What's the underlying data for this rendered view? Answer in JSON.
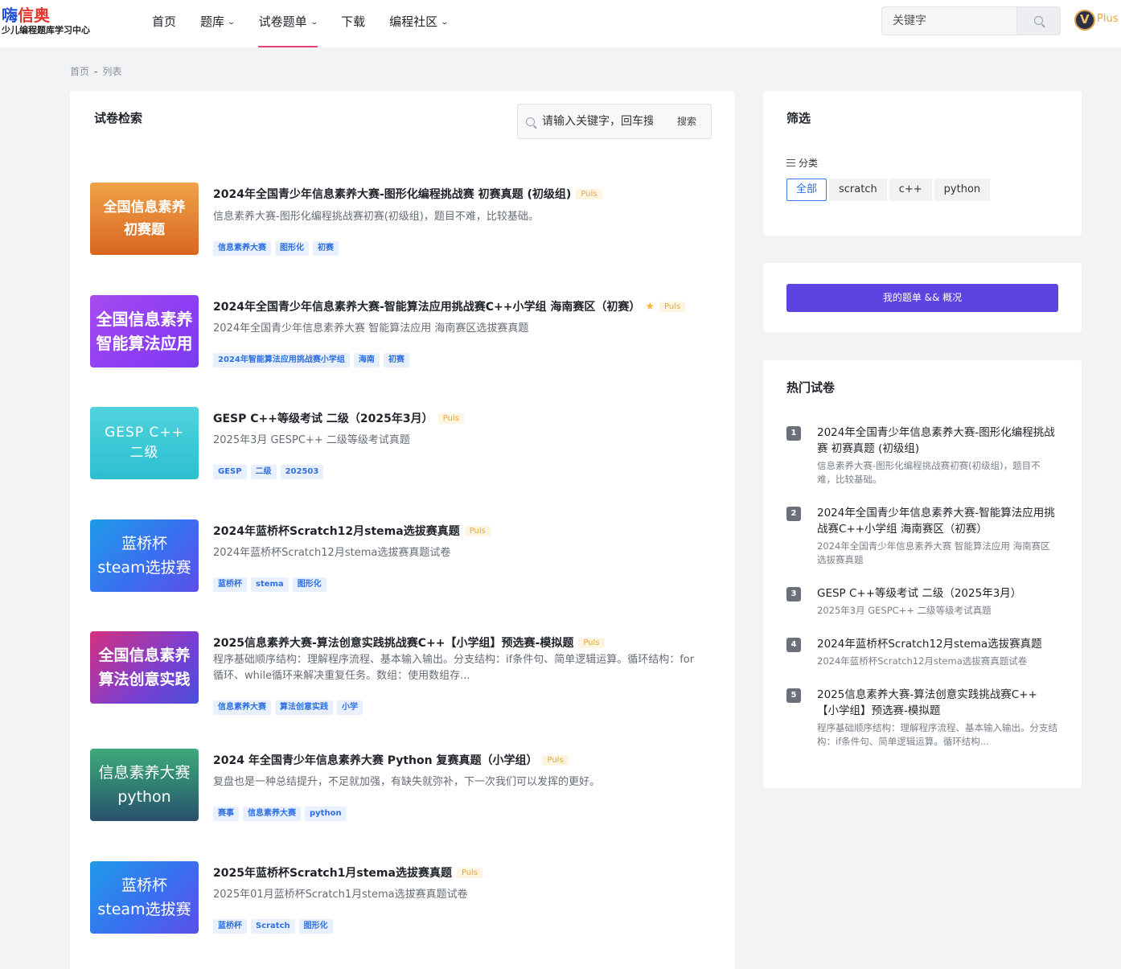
{
  "header": {
    "logo_main_blue": "嗨",
    "logo_main_red": "信奥",
    "logo_sub": "少儿编程题库学习中心",
    "nav": [
      {
        "label": "首页",
        "dropdown": false,
        "active": false
      },
      {
        "label": "题库",
        "dropdown": true,
        "active": false
      },
      {
        "label": "试卷题单",
        "dropdown": true,
        "active": true
      },
      {
        "label": "下载",
        "dropdown": false,
        "active": false
      },
      {
        "label": "编程社区",
        "dropdown": true,
        "active": false
      }
    ],
    "search_placeholder": "关键字",
    "plus_label": "Plus"
  },
  "breadcrumb": {
    "home": "首页",
    "sep": "-",
    "current": "列表"
  },
  "main": {
    "title": "试卷检索",
    "search_placeholder": "请输入关键字，回车搜索",
    "search_button": "搜索",
    "puls_label": "Puls",
    "items": [
      {
        "cover_lines": [
          "全国信息素养",
          "初赛题"
        ],
        "cover_style": "orange",
        "title": "2024年全国青少年信息素养大赛-图形化编程挑战赛 初赛真题 (初级组)",
        "starred": false,
        "desc": "信息素养大赛-图形化编程挑战赛初赛(初级组)，题目不难，比较基础。",
        "tags": [
          "信息素养大赛",
          "图形化",
          "初赛"
        ]
      },
      {
        "cover_lines": [
          "全国信息素养",
          "智能算法应用"
        ],
        "cover_style": "purple",
        "title": "2024年全国青少年信息素养大赛-智能算法应用挑战赛C++小学组 海南赛区（初赛）",
        "starred": true,
        "desc": "2024年全国青少年信息素养大赛 智能算法应用 海南赛区选拔赛真题",
        "tags": [
          "2024年智能算法应用挑战赛小学组",
          "海南",
          "初赛"
        ]
      },
      {
        "cover_lines": [
          "GESP C++",
          "二级"
        ],
        "cover_style": "cyan",
        "title": "GESP C++等级考试 二级（2025年3月）",
        "starred": false,
        "desc": "2025年3月 GESPC++ 二级等级考试真题",
        "tags": [
          "GESP",
          "二级",
          "202503"
        ]
      },
      {
        "cover_lines": [
          "蓝桥杯",
          "steam选拔赛"
        ],
        "cover_style": "blue",
        "title": "2024年蓝桥杯Scratch12月stema选拔赛真题",
        "starred": false,
        "desc": "2024年蓝桥杯Scratch12月stema选拔赛真题试卷",
        "tags": [
          "蓝桥杯",
          "stema",
          "图形化"
        ]
      },
      {
        "cover_lines": [
          "全国信息素养",
          "算法创意实践"
        ],
        "cover_style": "magenta",
        "title": "2025信息素养大赛-算法创意实践挑战赛C++【小学组】预选赛-模拟题",
        "starred": false,
        "desc": "程序基础顺序结构：理解程序流程、基本输入输出。分支结构：if条件句、简单逻辑运算。循环结构：for循环、while循环来解决重复任务。数组：使用数组存...",
        "tags": [
          "信息素养大赛",
          "算法创意实践",
          "小学"
        ]
      },
      {
        "cover_lines": [
          "信息素养大赛",
          "python"
        ],
        "cover_style": "green",
        "title": "2024 年全国青少年信息素养大赛 Python 复赛真题（小学组）",
        "starred": false,
        "desc": "复盘也是一种总结提升，不足就加强，有缺失就弥补，下一次我们可以发挥的更好。",
        "tags": [
          "赛事",
          "信息素养大赛",
          "python"
        ]
      },
      {
        "cover_lines": [
          "蓝桥杯",
          "steam选拔赛"
        ],
        "cover_style": "blue",
        "title": "2025年蓝桥杯Scratch1月stema选拔赛真题",
        "starred": false,
        "desc": "2025年01月蓝桥杯Scratch1月stema选拔赛真题试卷",
        "tags": [
          "蓝桥杯",
          "Scratch",
          "图形化"
        ]
      }
    ]
  },
  "filter": {
    "title": "筛选",
    "category_label": "分类",
    "categories": [
      "全部",
      "scratch",
      "c++",
      "python"
    ],
    "active_category": "全部"
  },
  "my_list_button": "我的题单 && 概况",
  "hot": {
    "title": "热门试卷",
    "items": [
      {
        "rank": "1",
        "title": "2024年全国青少年信息素养大赛-图形化编程挑战赛 初赛真题 (初级组)",
        "desc": "信息素养大赛-图形化编程挑战赛初赛(初级组)，题目不难，比较基础。"
      },
      {
        "rank": "2",
        "title": "2024年全国青少年信息素养大赛-智能算法应用挑战赛C++小学组 海南赛区（初赛）",
        "desc": "2024年全国青少年信息素养大赛 智能算法应用 海南赛区选拔赛真题"
      },
      {
        "rank": "3",
        "title": "GESP C++等级考试 二级（2025年3月）",
        "desc": "2025年3月 GESPC++ 二级等级考试真题"
      },
      {
        "rank": "4",
        "title": "2024年蓝桥杯Scratch12月stema选拔赛真题",
        "desc": "2024年蓝桥杯Scratch12月stema选拔赛真题试卷"
      },
      {
        "rank": "5",
        "title": "2025信息素养大赛-算法创意实践挑战赛C++【小学组】预选赛-模拟题",
        "desc": "程序基础顺序结构：理解程序流程、基本输入输出。分支结构：if条件句、简单逻辑运算。循环结构..."
      }
    ]
  },
  "colors": {
    "accent": "#5b44e0",
    "tag_blue": "#2f6fe0",
    "puls_gold": "#e7a93b",
    "nav_active": "#e0427a"
  }
}
